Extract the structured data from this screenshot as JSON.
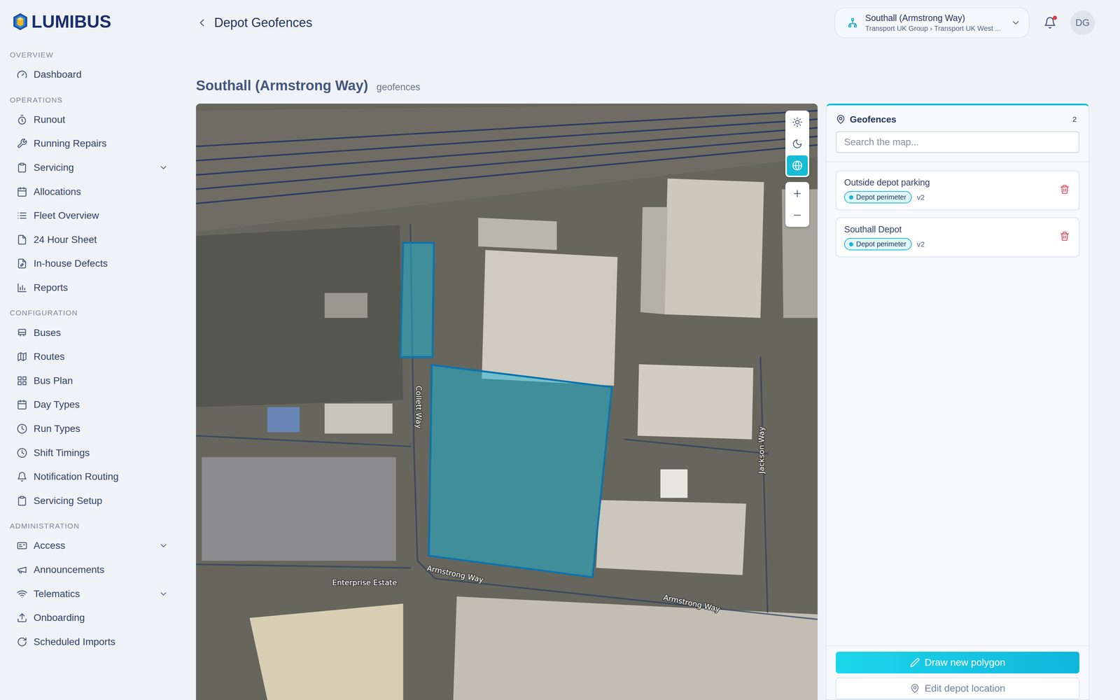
{
  "brand": {
    "name": "LUMIBUS"
  },
  "sidebar": {
    "sections": [
      {
        "label": "OVERVIEW",
        "items": [
          {
            "label": "Dashboard",
            "selected": false,
            "expandable": false,
            "expanded": false
          }
        ]
      },
      {
        "label": "OPERATIONS",
        "items": [
          {
            "label": "Runout",
            "selected": false,
            "expandable": false,
            "expanded": false
          },
          {
            "label": "Running Repairs",
            "selected": false,
            "expandable": false,
            "expanded": false
          },
          {
            "label": "Servicing",
            "selected": false,
            "expandable": true,
            "expanded": false
          },
          {
            "label": "Allocations",
            "selected": false,
            "expandable": false,
            "expanded": false
          },
          {
            "label": "Fleet Overview",
            "selected": false,
            "expandable": false,
            "expanded": false
          },
          {
            "label": "24 Hour Sheet",
            "selected": false,
            "expandable": false,
            "expanded": false
          },
          {
            "label": "In-house Defects",
            "selected": false,
            "expandable": false,
            "expanded": false
          },
          {
            "label": "Reports",
            "selected": false,
            "expandable": false,
            "expanded": false
          }
        ]
      },
      {
        "label": "CONFIGURATION",
        "items": [
          {
            "label": "Buses",
            "selected": false,
            "expandable": false,
            "expanded": false
          },
          {
            "label": "Routes",
            "selected": false,
            "expandable": false,
            "expanded": false
          },
          {
            "label": "Bus Plan",
            "selected": false,
            "expandable": false,
            "expanded": false
          },
          {
            "label": "Day Types",
            "selected": false,
            "expandable": false,
            "expanded": false
          },
          {
            "label": "Run Types",
            "selected": false,
            "expandable": false,
            "expanded": false
          },
          {
            "label": "Shift Timings",
            "selected": false,
            "expandable": false,
            "expanded": false
          },
          {
            "label": "Notification Routing",
            "selected": false,
            "expandable": false,
            "expanded": false
          },
          {
            "label": "Servicing Setup",
            "selected": false,
            "expandable": false,
            "expanded": false
          }
        ]
      },
      {
        "label": "ADMINISTRATION",
        "items": [
          {
            "label": "Access",
            "selected": false,
            "expandable": true,
            "expanded": false
          },
          {
            "label": "Announcements",
            "selected": false,
            "expandable": false,
            "expanded": false
          },
          {
            "label": "Telematics",
            "selected": false,
            "expandable": true,
            "expanded": false
          },
          {
            "label": "Onboarding",
            "selected": false,
            "expandable": false,
            "expanded": false
          },
          {
            "label": "Scheduled Imports",
            "selected": false,
            "expandable": false,
            "expanded": false
          }
        ]
      }
    ]
  },
  "header": {
    "title": "Depot Geofences",
    "depot": {
      "name": "Southall (Armstrong Way)",
      "path": "Transport UK Group › Transport UK West ..."
    },
    "notifications": {
      "unread": true
    },
    "user": {
      "initials": "DG"
    }
  },
  "page": {
    "title": "Southall (Armstrong Way)",
    "subtitle": "geofences"
  },
  "map": {
    "styles": [
      {
        "kind": "light",
        "selected": false
      },
      {
        "kind": "dark",
        "selected": false
      },
      {
        "kind": "satellite",
        "selected": true
      }
    ],
    "labels": [
      {
        "text": "Collett Way"
      },
      {
        "text": "Jackson Way"
      },
      {
        "text": "Armstrong Way"
      },
      {
        "text": "Armstrong Way"
      },
      {
        "text": "Enterprise Estate"
      }
    ]
  },
  "panel": {
    "title": "Geofences",
    "count": "2",
    "search": {
      "placeholder": "Search the map..."
    },
    "geofences": [
      {
        "name": "Outside depot parking",
        "tag": {
          "label": "Depot perimeter",
          "color": "#17b6d6"
        },
        "version": "v2",
        "selected": false
      },
      {
        "name": "Southall Depot",
        "tag": {
          "label": "Depot perimeter",
          "color": "#17b6d6"
        },
        "version": "v2",
        "selected": false
      }
    ],
    "buttons": [
      {
        "label": "Draw new polygon",
        "kind": "primary"
      },
      {
        "label": "Edit depot location",
        "kind": "secondary"
      }
    ]
  }
}
